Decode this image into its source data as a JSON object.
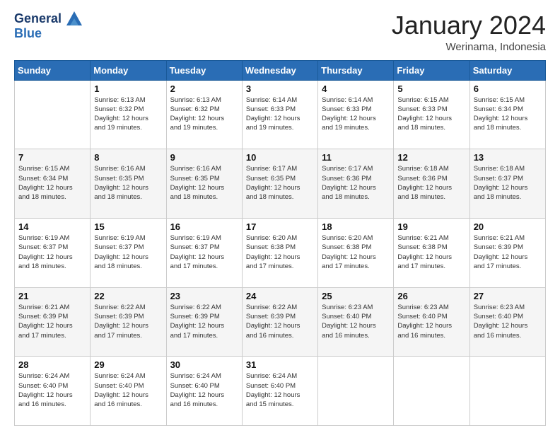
{
  "header": {
    "logo_line1": "General",
    "logo_line2": "Blue",
    "month_title": "January 2024",
    "location": "Werinama, Indonesia"
  },
  "days_of_week": [
    "Sunday",
    "Monday",
    "Tuesday",
    "Wednesday",
    "Thursday",
    "Friday",
    "Saturday"
  ],
  "weeks": [
    [
      {
        "day": "",
        "info": ""
      },
      {
        "day": "1",
        "info": "Sunrise: 6:13 AM\nSunset: 6:32 PM\nDaylight: 12 hours\nand 19 minutes."
      },
      {
        "day": "2",
        "info": "Sunrise: 6:13 AM\nSunset: 6:32 PM\nDaylight: 12 hours\nand 19 minutes."
      },
      {
        "day": "3",
        "info": "Sunrise: 6:14 AM\nSunset: 6:33 PM\nDaylight: 12 hours\nand 19 minutes."
      },
      {
        "day": "4",
        "info": "Sunrise: 6:14 AM\nSunset: 6:33 PM\nDaylight: 12 hours\nand 19 minutes."
      },
      {
        "day": "5",
        "info": "Sunrise: 6:15 AM\nSunset: 6:33 PM\nDaylight: 12 hours\nand 18 minutes."
      },
      {
        "day": "6",
        "info": "Sunrise: 6:15 AM\nSunset: 6:34 PM\nDaylight: 12 hours\nand 18 minutes."
      }
    ],
    [
      {
        "day": "7",
        "info": "Sunrise: 6:15 AM\nSunset: 6:34 PM\nDaylight: 12 hours\nand 18 minutes."
      },
      {
        "day": "8",
        "info": "Sunrise: 6:16 AM\nSunset: 6:35 PM\nDaylight: 12 hours\nand 18 minutes."
      },
      {
        "day": "9",
        "info": "Sunrise: 6:16 AM\nSunset: 6:35 PM\nDaylight: 12 hours\nand 18 minutes."
      },
      {
        "day": "10",
        "info": "Sunrise: 6:17 AM\nSunset: 6:35 PM\nDaylight: 12 hours\nand 18 minutes."
      },
      {
        "day": "11",
        "info": "Sunrise: 6:17 AM\nSunset: 6:36 PM\nDaylight: 12 hours\nand 18 minutes."
      },
      {
        "day": "12",
        "info": "Sunrise: 6:18 AM\nSunset: 6:36 PM\nDaylight: 12 hours\nand 18 minutes."
      },
      {
        "day": "13",
        "info": "Sunrise: 6:18 AM\nSunset: 6:37 PM\nDaylight: 12 hours\nand 18 minutes."
      }
    ],
    [
      {
        "day": "14",
        "info": "Sunrise: 6:19 AM\nSunset: 6:37 PM\nDaylight: 12 hours\nand 18 minutes."
      },
      {
        "day": "15",
        "info": "Sunrise: 6:19 AM\nSunset: 6:37 PM\nDaylight: 12 hours\nand 18 minutes."
      },
      {
        "day": "16",
        "info": "Sunrise: 6:19 AM\nSunset: 6:37 PM\nDaylight: 12 hours\nand 17 minutes."
      },
      {
        "day": "17",
        "info": "Sunrise: 6:20 AM\nSunset: 6:38 PM\nDaylight: 12 hours\nand 17 minutes."
      },
      {
        "day": "18",
        "info": "Sunrise: 6:20 AM\nSunset: 6:38 PM\nDaylight: 12 hours\nand 17 minutes."
      },
      {
        "day": "19",
        "info": "Sunrise: 6:21 AM\nSunset: 6:38 PM\nDaylight: 12 hours\nand 17 minutes."
      },
      {
        "day": "20",
        "info": "Sunrise: 6:21 AM\nSunset: 6:39 PM\nDaylight: 12 hours\nand 17 minutes."
      }
    ],
    [
      {
        "day": "21",
        "info": "Sunrise: 6:21 AM\nSunset: 6:39 PM\nDaylight: 12 hours\nand 17 minutes."
      },
      {
        "day": "22",
        "info": "Sunrise: 6:22 AM\nSunset: 6:39 PM\nDaylight: 12 hours\nand 17 minutes."
      },
      {
        "day": "23",
        "info": "Sunrise: 6:22 AM\nSunset: 6:39 PM\nDaylight: 12 hours\nand 17 minutes."
      },
      {
        "day": "24",
        "info": "Sunrise: 6:22 AM\nSunset: 6:39 PM\nDaylight: 12 hours\nand 16 minutes."
      },
      {
        "day": "25",
        "info": "Sunrise: 6:23 AM\nSunset: 6:40 PM\nDaylight: 12 hours\nand 16 minutes."
      },
      {
        "day": "26",
        "info": "Sunrise: 6:23 AM\nSunset: 6:40 PM\nDaylight: 12 hours\nand 16 minutes."
      },
      {
        "day": "27",
        "info": "Sunrise: 6:23 AM\nSunset: 6:40 PM\nDaylight: 12 hours\nand 16 minutes."
      }
    ],
    [
      {
        "day": "28",
        "info": "Sunrise: 6:24 AM\nSunset: 6:40 PM\nDaylight: 12 hours\nand 16 minutes."
      },
      {
        "day": "29",
        "info": "Sunrise: 6:24 AM\nSunset: 6:40 PM\nDaylight: 12 hours\nand 16 minutes."
      },
      {
        "day": "30",
        "info": "Sunrise: 6:24 AM\nSunset: 6:40 PM\nDaylight: 12 hours\nand 16 minutes."
      },
      {
        "day": "31",
        "info": "Sunrise: 6:24 AM\nSunset: 6:40 PM\nDaylight: 12 hours\nand 15 minutes."
      },
      {
        "day": "",
        "info": ""
      },
      {
        "day": "",
        "info": ""
      },
      {
        "day": "",
        "info": ""
      }
    ]
  ]
}
